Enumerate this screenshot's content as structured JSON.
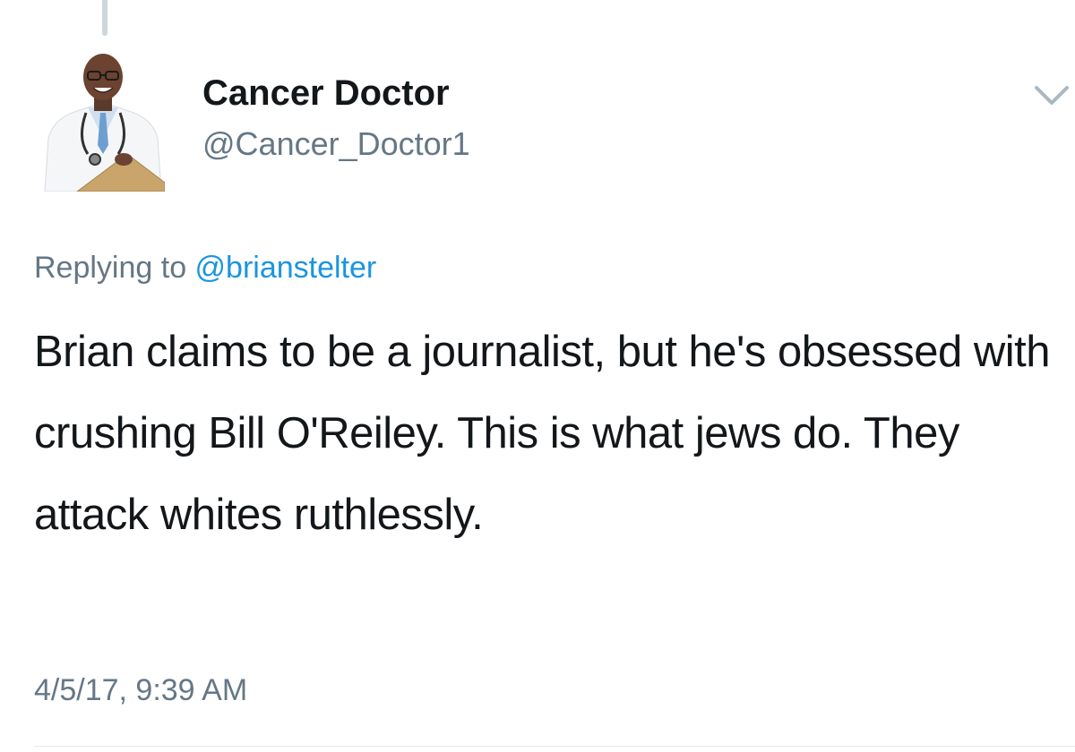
{
  "tweet": {
    "author": {
      "name": "Cancer Doctor",
      "handle": "@Cancer_Doctor1"
    },
    "reply": {
      "prefix": "Replying to ",
      "to_handle": "@brianstelter"
    },
    "text": "Brian claims to be a journalist, but he's obsessed with crushing Bill O'Reiley. This is what jews do.  They attack whites ruthlessly.",
    "timestamp": "4/5/17, 9:39 AM"
  },
  "icons": {
    "menu": "chevron-down-icon",
    "avatar": "doctor-portrait"
  },
  "colors": {
    "text": "#14171a",
    "muted": "#657786",
    "link": "#1b95e0"
  }
}
